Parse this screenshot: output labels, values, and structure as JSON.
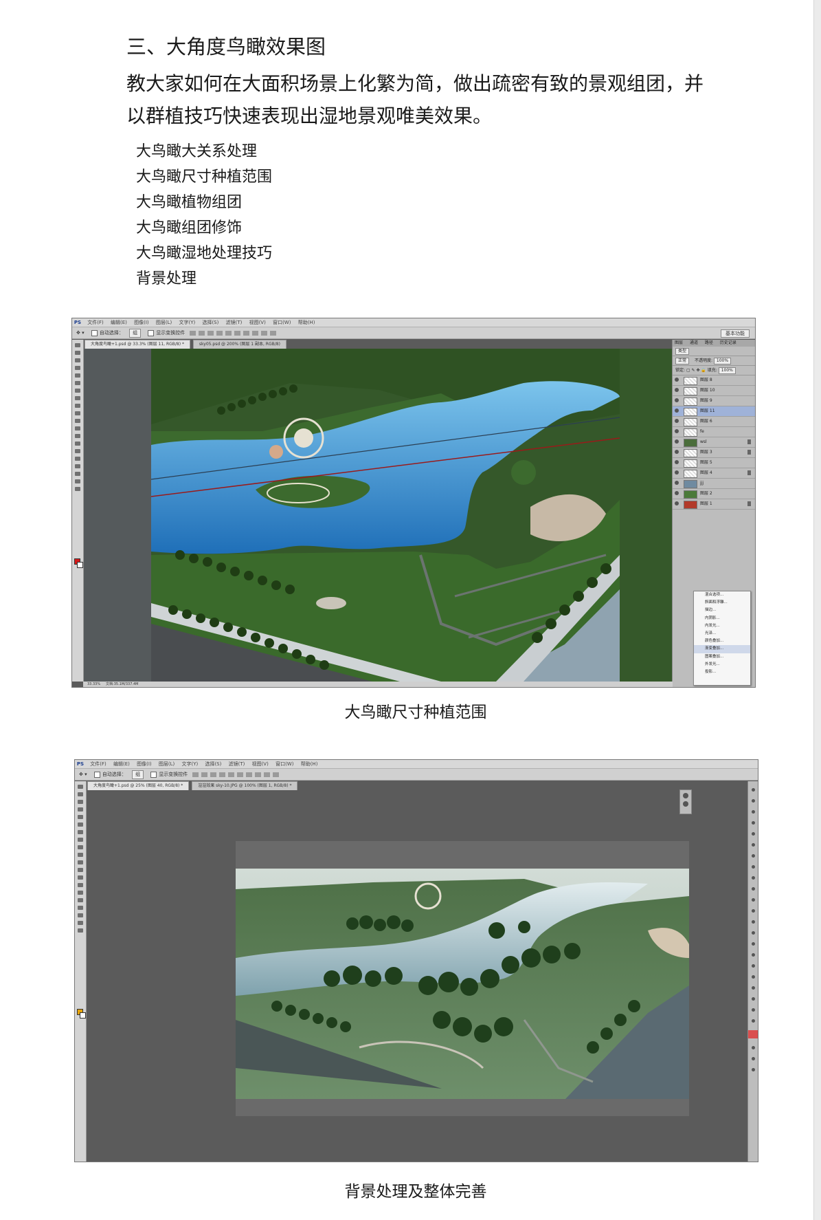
{
  "section_heading": "三、大角度鸟瞰效果图",
  "intro_text": "教大家如何在大面积场景上化繁为简，做出疏密有致的景观组团，并以群植技巧快速表现出湿地景观唯美效果。",
  "topics": [
    "大鸟瞰大关系处理",
    "大鸟瞰尺寸种植范围",
    "大鸟瞰植物组团",
    "大鸟瞰组团修饰",
    "大鸟瞰湿地处理技巧",
    "背景处理"
  ],
  "captions": {
    "figure1": "大鸟瞰尺寸种植范围",
    "figure2": "背景处理及整体完善"
  },
  "ps_ui": {
    "logo": "PS",
    "menus": [
      "文件(F)",
      "编辑(E)",
      "图像(I)",
      "图层(L)",
      "文字(Y)",
      "选择(S)",
      "滤镜(T)",
      "视图(V)",
      "窗口(W)",
      "帮助(H)"
    ],
    "auto_select": "自动选择：",
    "auto_select_target": "组",
    "show_transform": "显示变换控件",
    "workspace": "基本功能",
    "window1_tabs": [
      "大角度鸟瞰+1.psd @ 33.3% (图层 11, RGB/8) *",
      "sky05.psd @ 200% (图层 1 副本, RGB/8)"
    ],
    "window1_zoom": "33.33%",
    "window1_doc": "文档:35.1M/337.4M",
    "window2_tabs": [
      "大角度鸟瞰+1.psd @ 25% (图层 40, RGB/8) *",
      "渲渲效果 sky-10.JPG @ 100% (图层 1, RGB/8) *"
    ],
    "panel_tabs": [
      "图层",
      "通道",
      "路径",
      "历史记录"
    ],
    "filter_kind": "类型",
    "blend_mode": "正常",
    "opacity_label": "不透明度:",
    "opacity_value": "100%",
    "lock_label": "锁定:",
    "fill_label": "填充:",
    "fill_value": "100%",
    "layers": [
      "图层 8",
      "图层 10",
      "图层 9",
      "图层 11",
      "图层 6",
      "fe",
      "wsl",
      "图层 3",
      "图层 5",
      "图层 4",
      "jjj",
      "图层 2",
      "图层 1"
    ],
    "selected_layer_index": 3,
    "context_menu": [
      "混合选项...",
      "斜面和浮雕...",
      "描边...",
      "内阴影...",
      "内发光...",
      "光泽...",
      "颜色叠加...",
      "渐变叠加...",
      "图案叠加...",
      "外发光...",
      "投影..."
    ],
    "context_menu_highlight_index": 7
  }
}
